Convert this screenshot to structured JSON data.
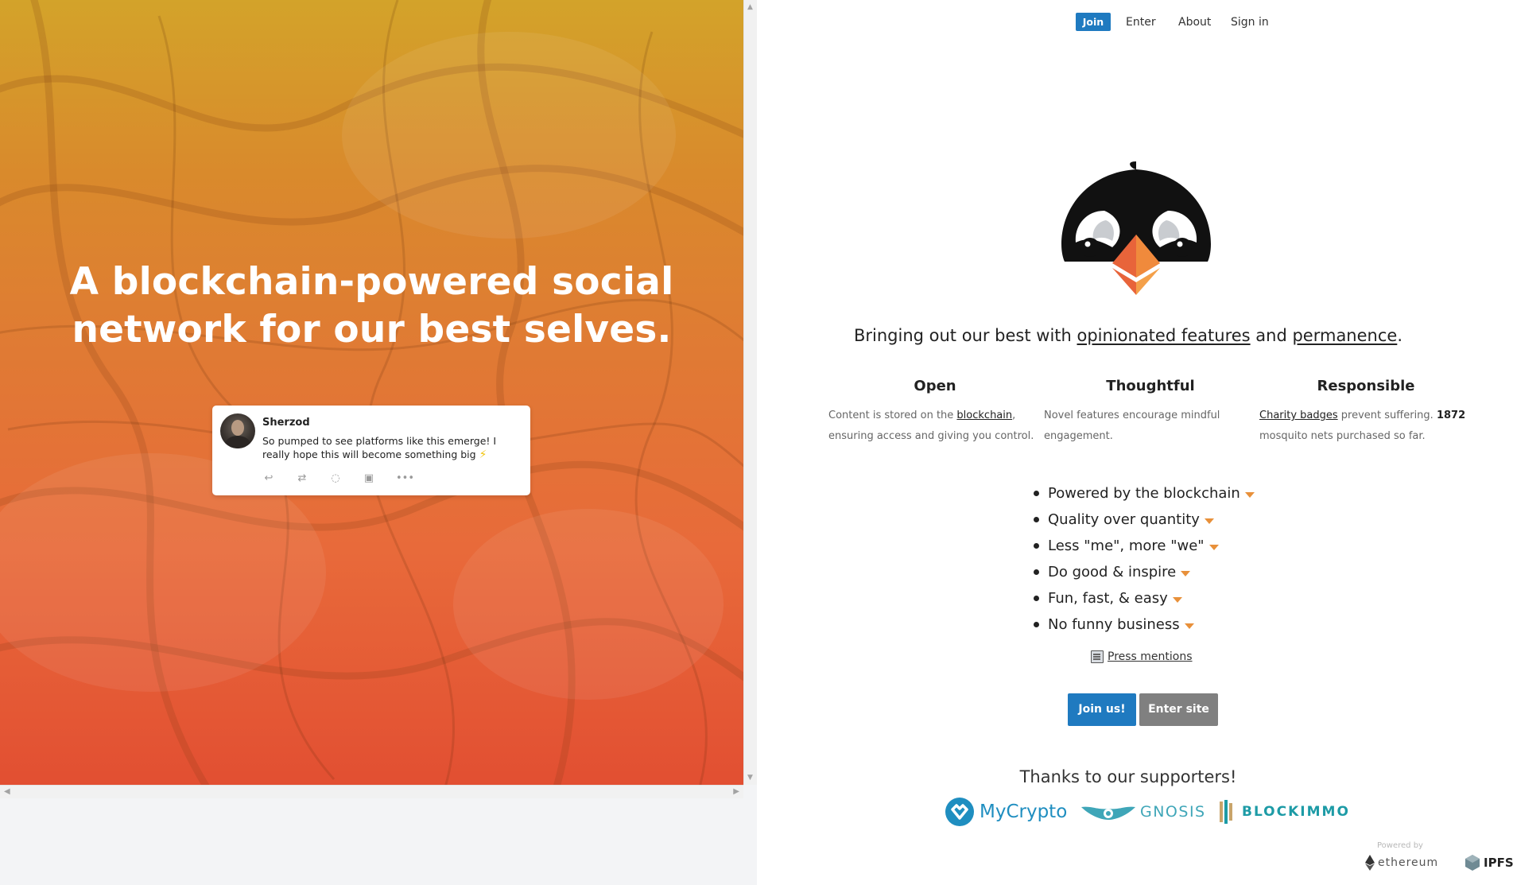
{
  "hero": {
    "title": "A blockchain-powered social network for our best selves."
  },
  "sample_post": {
    "author": "Sherzod",
    "message": "So pumped to see platforms like this emerge! I really hope this will become something big",
    "actions": [
      "reply-icon",
      "repost-icon",
      "like-icon",
      "tip-icon",
      "more-icon"
    ]
  },
  "nav": {
    "join_label": "Join",
    "links": [
      "Enter",
      "About",
      "Sign in"
    ]
  },
  "tagline": {
    "prefix": "Bringing out our best with ",
    "link1": "opinionated features",
    "middle": " and ",
    "link2": "permanence",
    "suffix": "."
  },
  "columns": [
    {
      "title": "Open",
      "text_before": "Content is stored on the ",
      "link": "blockchain",
      "text_after": ", ensuring access and giving you control."
    },
    {
      "title": "Thoughtful",
      "text_before": "Novel features encourage mindful engagement.",
      "link": "",
      "text_after": ""
    },
    {
      "title": "Responsible",
      "text_before": "",
      "link": "Charity badges",
      "text_after": " prevent suffering. ",
      "count": "1872",
      "text_end": " mosquito nets purchased so far."
    }
  ],
  "features": [
    "Powered by the blockchain",
    "Quality over quantity",
    "Less \"me\", more \"we\"",
    "Do good & inspire",
    "Fun, fast, & easy",
    "No funny business"
  ],
  "press_label": "Press mentions",
  "buttons": {
    "join_us": "Join us!",
    "enter_site": "Enter site"
  },
  "supporters": {
    "heading": "Thanks to our supporters!",
    "names": [
      "MyCrypto",
      "GNOSIS",
      "BLOCKIMMO"
    ]
  },
  "powered_by": {
    "label": "Powered by",
    "ethereum": "ethereum",
    "ipfs": "IPFS"
  },
  "colors": {
    "primary": "#1f7ac0",
    "secondary": "#808080",
    "accent_caret": "#e8903a",
    "mycrypto": "#1f8ec0",
    "gnosis": "#3fa6b8",
    "blockimmo": "#1d9ba6"
  }
}
